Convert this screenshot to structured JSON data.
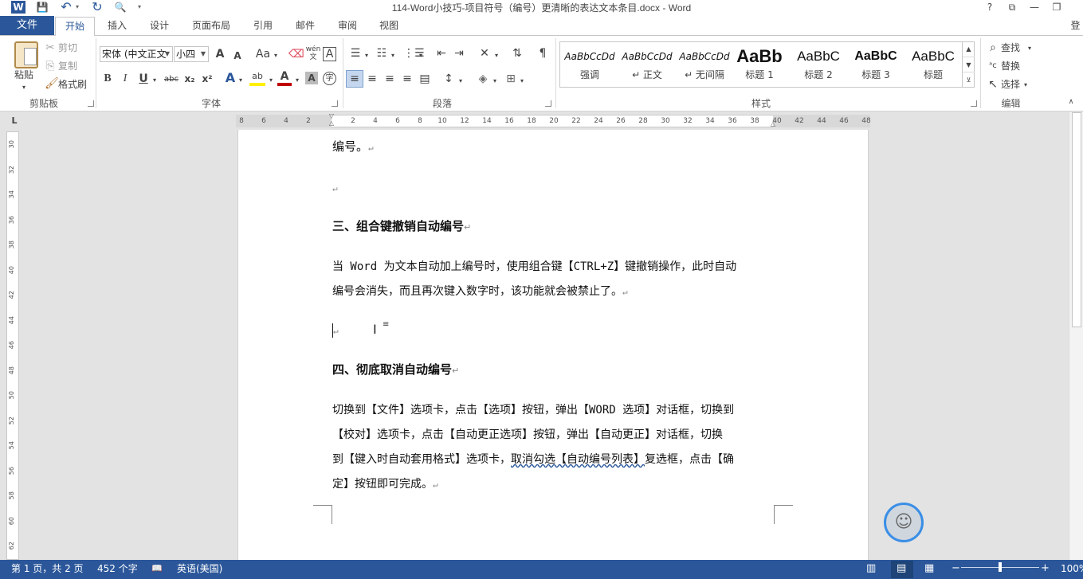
{
  "window": {
    "title": "114-Word小技巧-项目符号（编号）更清晰的表达文本条目.docx - Word",
    "help": "?",
    "ribbon_display": "⧉",
    "minimize": "—",
    "restore": "❐",
    "signin": "登"
  },
  "qat": {
    "word_logo": "W",
    "save": "💾",
    "undo": "↶",
    "redo": "↻",
    "preview": "🔍",
    "customize": "▾"
  },
  "tabs": {
    "file": "文件",
    "home": "开始",
    "insert": "插入",
    "design": "设计",
    "layout": "页面布局",
    "references": "引用",
    "mailings": "邮件",
    "review": "审阅",
    "view": "视图"
  },
  "clipboard": {
    "paste": "粘贴",
    "cut": "剪切",
    "copy": "复制",
    "format_painter": "格式刷",
    "group": "剪贴板"
  },
  "font": {
    "name": "宋体 (中文正文",
    "size": "小四",
    "group": "字体",
    "bold": "B",
    "italic": "I",
    "underline": "U",
    "strike": "abc",
    "subscript": "x₂",
    "superscript": "x²",
    "grow": "A",
    "shrink": "A",
    "case": "Aa",
    "wen": "wén",
    "border_char": "A",
    "effects": "A",
    "highlight": "ab",
    "color": "A",
    "shading": "A",
    "circle": "字"
  },
  "paragraph": {
    "group": "段落"
  },
  "styles": {
    "group": "样式",
    "items": [
      {
        "sample": "AaBbCcDd",
        "name": "强调"
      },
      {
        "sample": "AaBbCcDd",
        "name": "↵ 正文"
      },
      {
        "sample": "AaBbCcDd",
        "name": "↵ 无间隔"
      },
      {
        "sample": "AaBb",
        "name": "标题 1"
      },
      {
        "sample": "AaBbC",
        "name": "标题 2"
      },
      {
        "sample": "AaBbC",
        "name": "标题 3"
      },
      {
        "sample": "AaBbC",
        "name": "标题"
      }
    ]
  },
  "editing": {
    "find": "查找",
    "replace": "替换",
    "select": "选择",
    "group": "编辑"
  },
  "ruler": {
    "corner": "L",
    "h_ticks": [
      "8",
      "6",
      "4",
      "2",
      "2",
      "4",
      "6",
      "8",
      "10",
      "12",
      "14",
      "16",
      "18",
      "20",
      "22",
      "24",
      "26",
      "28",
      "30",
      "32",
      "34",
      "36",
      "38",
      "40",
      "42",
      "44",
      "46",
      "48"
    ],
    "v_ticks": [
      "30",
      "32",
      "34",
      "36",
      "38",
      "40",
      "42",
      "44",
      "46",
      "48",
      "50",
      "52",
      "54",
      "56",
      "58",
      "60",
      "62"
    ]
  },
  "document": {
    "p1": "编号。",
    "p2": "",
    "h3": "三、组合键撤销自动编号",
    "p3a": "当 Word 为文本自动加上编号时，使用组合键【CTRL+Z】键撤销操作，此时自动",
    "p3b": "编号会消失，而且再次键入数字时，该功能就会被禁止了。",
    "h4": "四、彻底取消自动编号",
    "p4a": "切换到【文件】选项卡，点击【选项】按钮，弹出【WORD 选项】对话框，切换到",
    "p4b": "【校对】选项卡，点击【自动更正选项】按钮，弹出【自动更正】对话框，切换",
    "p4c_pre": "到【键入时自动套用格式】选项卡，",
    "p4c_under": "取消勾选【自动编号列表】",
    "p4c_post": "复选框，点击【确",
    "p4d": "定】按钮即可完成。",
    "para_mark": "↵"
  },
  "status": {
    "page": "第 1 页，共 2 页",
    "words": "452 个字",
    "proof": "📖",
    "lang": "英语(美国)",
    "zoom": "100%",
    "zoom_level": 1.0
  },
  "colors": {
    "accent": "#2b579a",
    "ribbon_bg": "#ffffff",
    "canvas": "#e3e3e3"
  }
}
